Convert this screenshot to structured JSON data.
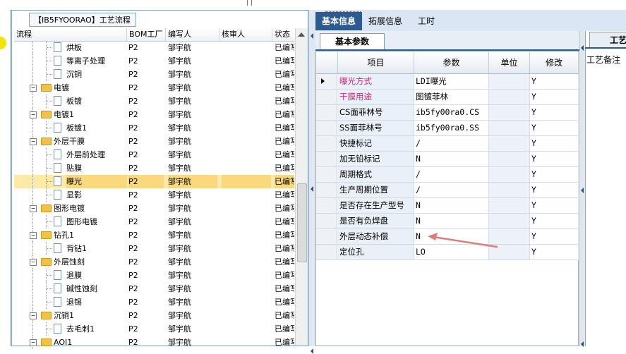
{
  "tree_panel": {
    "title": "【IB5FYOORAO】工艺流程",
    "columns": [
      "流程",
      "BOM工厂",
      "编写人",
      "核审人",
      "状态"
    ],
    "rows": [
      {
        "level": 2,
        "type": "doc",
        "name": "烘板",
        "factory": "P2",
        "writer": "邹宇航",
        "reviewer": "",
        "status": "已编写"
      },
      {
        "level": 2,
        "type": "doc",
        "name": "等离子处理",
        "factory": "P2",
        "writer": "邹宇航",
        "reviewer": "",
        "status": "已编写"
      },
      {
        "level": 2,
        "type": "doc",
        "name": "沉铜",
        "factory": "P2",
        "writer": "邹宇航",
        "reviewer": "",
        "status": "已编写"
      },
      {
        "level": 1,
        "type": "folder",
        "name": "电镀",
        "factory": "P2",
        "writer": "邹宇航",
        "reviewer": "",
        "status": "已编写"
      },
      {
        "level": 2,
        "type": "doc",
        "name": "板镀",
        "factory": "P2",
        "writer": "邹宇航",
        "reviewer": "",
        "status": "已编写"
      },
      {
        "level": 1,
        "type": "folder",
        "name": "电镀1",
        "factory": "P2",
        "writer": "邹宇航",
        "reviewer": "",
        "status": "已编写"
      },
      {
        "level": 2,
        "type": "doc",
        "name": "板镀1",
        "factory": "P2",
        "writer": "邹宇航",
        "reviewer": "",
        "status": "已编写"
      },
      {
        "level": 1,
        "type": "folder",
        "name": "外层干膜",
        "factory": "P2",
        "writer": "邹宇航",
        "reviewer": "",
        "status": "已编写"
      },
      {
        "level": 2,
        "type": "doc",
        "name": "外层前处理",
        "factory": "P2",
        "writer": "邹宇航",
        "reviewer": "",
        "status": "已编写"
      },
      {
        "level": 2,
        "type": "doc",
        "name": "贴膜",
        "factory": "P2",
        "writer": "邹宇航",
        "reviewer": "",
        "status": "已编写"
      },
      {
        "level": 2,
        "type": "doc",
        "name": "曝光",
        "factory": "P2",
        "writer": "邹宇航",
        "reviewer": "",
        "status": "已编写",
        "selected": true
      },
      {
        "level": 2,
        "type": "doc",
        "name": "显影",
        "factory": "P2",
        "writer": "邹宇航",
        "reviewer": "",
        "status": "已编写"
      },
      {
        "level": 1,
        "type": "folder",
        "name": "图形电镀",
        "factory": "P2",
        "writer": "邹宇航",
        "reviewer": "",
        "status": "已编写"
      },
      {
        "level": 2,
        "type": "doc",
        "name": "图形电镀",
        "factory": "P2",
        "writer": "邹宇航",
        "reviewer": "",
        "status": "已编写"
      },
      {
        "level": 1,
        "type": "folder",
        "name": "钻孔1",
        "factory": "P2",
        "writer": "邹宇航",
        "reviewer": "",
        "status": "已编写"
      },
      {
        "level": 2,
        "type": "doc",
        "name": "背钻1",
        "factory": "P2",
        "writer": "邹宇航",
        "reviewer": "",
        "status": "已编写"
      },
      {
        "level": 1,
        "type": "folder",
        "name": "外层蚀刻",
        "factory": "P2",
        "writer": "邹宇航",
        "reviewer": "",
        "status": "已编写"
      },
      {
        "level": 2,
        "type": "doc",
        "name": "退膜",
        "factory": "P2",
        "writer": "邹宇航",
        "reviewer": "",
        "status": "已编写"
      },
      {
        "level": 2,
        "type": "doc",
        "name": "碱性蚀刻",
        "factory": "P2",
        "writer": "邹宇航",
        "reviewer": "",
        "status": "已编写"
      },
      {
        "level": 2,
        "type": "doc",
        "name": "退锡",
        "factory": "P2",
        "writer": "邹宇航",
        "reviewer": "",
        "status": "已编写"
      },
      {
        "level": 1,
        "type": "folder",
        "name": "沉铜1",
        "factory": "P2",
        "writer": "邹宇航",
        "reviewer": "",
        "status": "已编写"
      },
      {
        "level": 2,
        "type": "doc",
        "name": "去毛刺1",
        "factory": "P2",
        "writer": "邹宇航",
        "reviewer": "",
        "status": "已编写"
      },
      {
        "level": 1,
        "type": "folder",
        "name": "AOI1",
        "factory": "P2",
        "writer": "邹宇航",
        "reviewer": "",
        "status": "已编写"
      }
    ]
  },
  "tabs": [
    "基本信息",
    "拓展信息",
    "工时"
  ],
  "subtab": "基本参数",
  "param_grid": {
    "columns": [
      "项目",
      "参数",
      "单位",
      "修改"
    ],
    "rows": [
      {
        "item": "曝光方式",
        "value": "LDI曝光",
        "unit": "",
        "modify": "Y",
        "highlight": true,
        "current": true
      },
      {
        "item": "干膜用途",
        "value": "图镀菲林",
        "unit": "",
        "modify": "Y",
        "highlight": true
      },
      {
        "item": "CS面菲林号",
        "value": "ib5fy00ra0.CS",
        "unit": "",
        "modify": "Y"
      },
      {
        "item": "SS面菲林号",
        "value": "ib5fy00ra0.SS",
        "unit": "",
        "modify": "Y"
      },
      {
        "item": "快捷标记",
        "value": "/",
        "unit": "",
        "modify": "Y"
      },
      {
        "item": "加无铅标记",
        "value": "N",
        "unit": "",
        "modify": "Y"
      },
      {
        "item": "周期格式",
        "value": "/",
        "unit": "",
        "modify": "Y"
      },
      {
        "item": "生产周期位置",
        "value": "/",
        "unit": "",
        "modify": "Y"
      },
      {
        "item": "是否存在生产型号",
        "value": "N",
        "unit": "",
        "modify": "Y"
      },
      {
        "item": "是否有负焊盘",
        "value": "N",
        "unit": "",
        "modify": "Y"
      },
      {
        "item": "外层动态补偿",
        "value": "N",
        "unit": "",
        "modify": "Y"
      },
      {
        "item": "定位孔",
        "value": "LO",
        "unit": "",
        "modify": "Y"
      }
    ]
  },
  "far_panel": {
    "tab": "工艺",
    "label": "工艺备注"
  },
  "colors": {
    "accent": "#2c5b93",
    "highlight_text": "#c62d7a",
    "selection": "#f9d87e",
    "annotation_arrow": "#e07b7b"
  }
}
